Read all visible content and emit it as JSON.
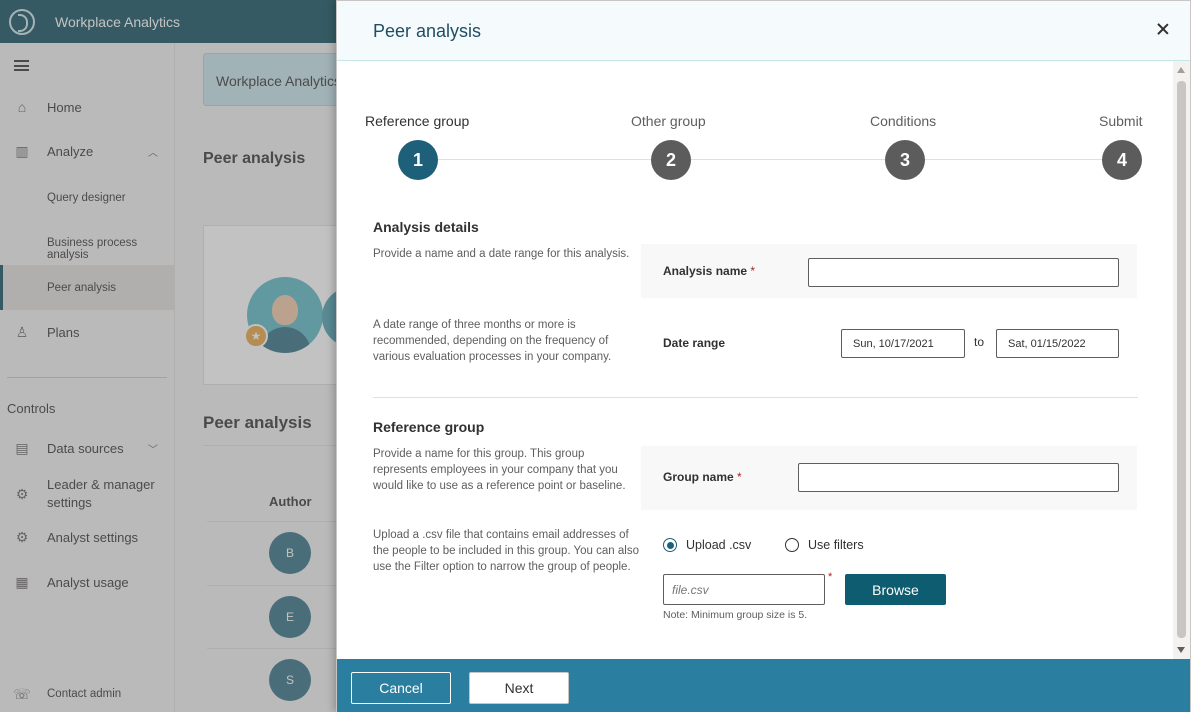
{
  "app": {
    "title": "Workplace Analytics"
  },
  "sidebar": {
    "items": [
      {
        "label": "Home"
      },
      {
        "label": "Analyze"
      },
      {
        "label": "Query designer"
      },
      {
        "label": "Business process analysis"
      },
      {
        "label": "Peer analysis"
      },
      {
        "label": "Plans"
      }
    ],
    "controls_heading": "Controls",
    "controls": [
      {
        "label": "Data sources"
      },
      {
        "label": "Leader & manager settings"
      },
      {
        "label": "Analyst settings"
      },
      {
        "label": "Analyst usage"
      }
    ],
    "contact": "Contact admin"
  },
  "background": {
    "banner": "Workplace Analytics",
    "heading": "Peer analysis",
    "list_heading": "Peer analysis",
    "author_column": "Author",
    "avatars": [
      "B",
      "E",
      "S"
    ]
  },
  "panel": {
    "title": "Peer analysis",
    "steps": [
      {
        "label": "Reference group",
        "number": "1"
      },
      {
        "label": "Other group",
        "number": "2"
      },
      {
        "label": "Conditions",
        "number": "3"
      },
      {
        "label": "Submit",
        "number": "4"
      }
    ],
    "analysis_details": {
      "title": "Analysis details",
      "desc_name": "Provide a name and a date range for this analysis.",
      "name_label": "Analysis name",
      "desc_range": "A date range of three months or more is recommended, depending on the frequency of various evaluation processes in your company.",
      "range_label": "Date range",
      "start_date": "Sun, 10/17/2021",
      "to_label": "to",
      "end_date": "Sat, 01/15/2022"
    },
    "reference_group": {
      "title": "Reference group",
      "desc_name": "Provide a name for this group. This group represents employees in your company that you would like to use as a reference point or baseline.",
      "group_label": "Group name",
      "desc_upload": "Upload a .csv file that contains email addresses of the people to be included in this group. You can also use the Filter option to narrow the group of people.",
      "option_upload": "Upload .csv",
      "option_filters": "Use filters",
      "file_placeholder": "file.csv",
      "browse_label": "Browse",
      "note": "Note: Minimum group size is 5."
    },
    "required_marker": "*",
    "footer": {
      "cancel": "Cancel",
      "next": "Next"
    }
  },
  "colors": {
    "brand": "#0e4d5c",
    "accent": "#1e5f7a",
    "footer": "#2a7fa0",
    "required": "#a4262c"
  }
}
